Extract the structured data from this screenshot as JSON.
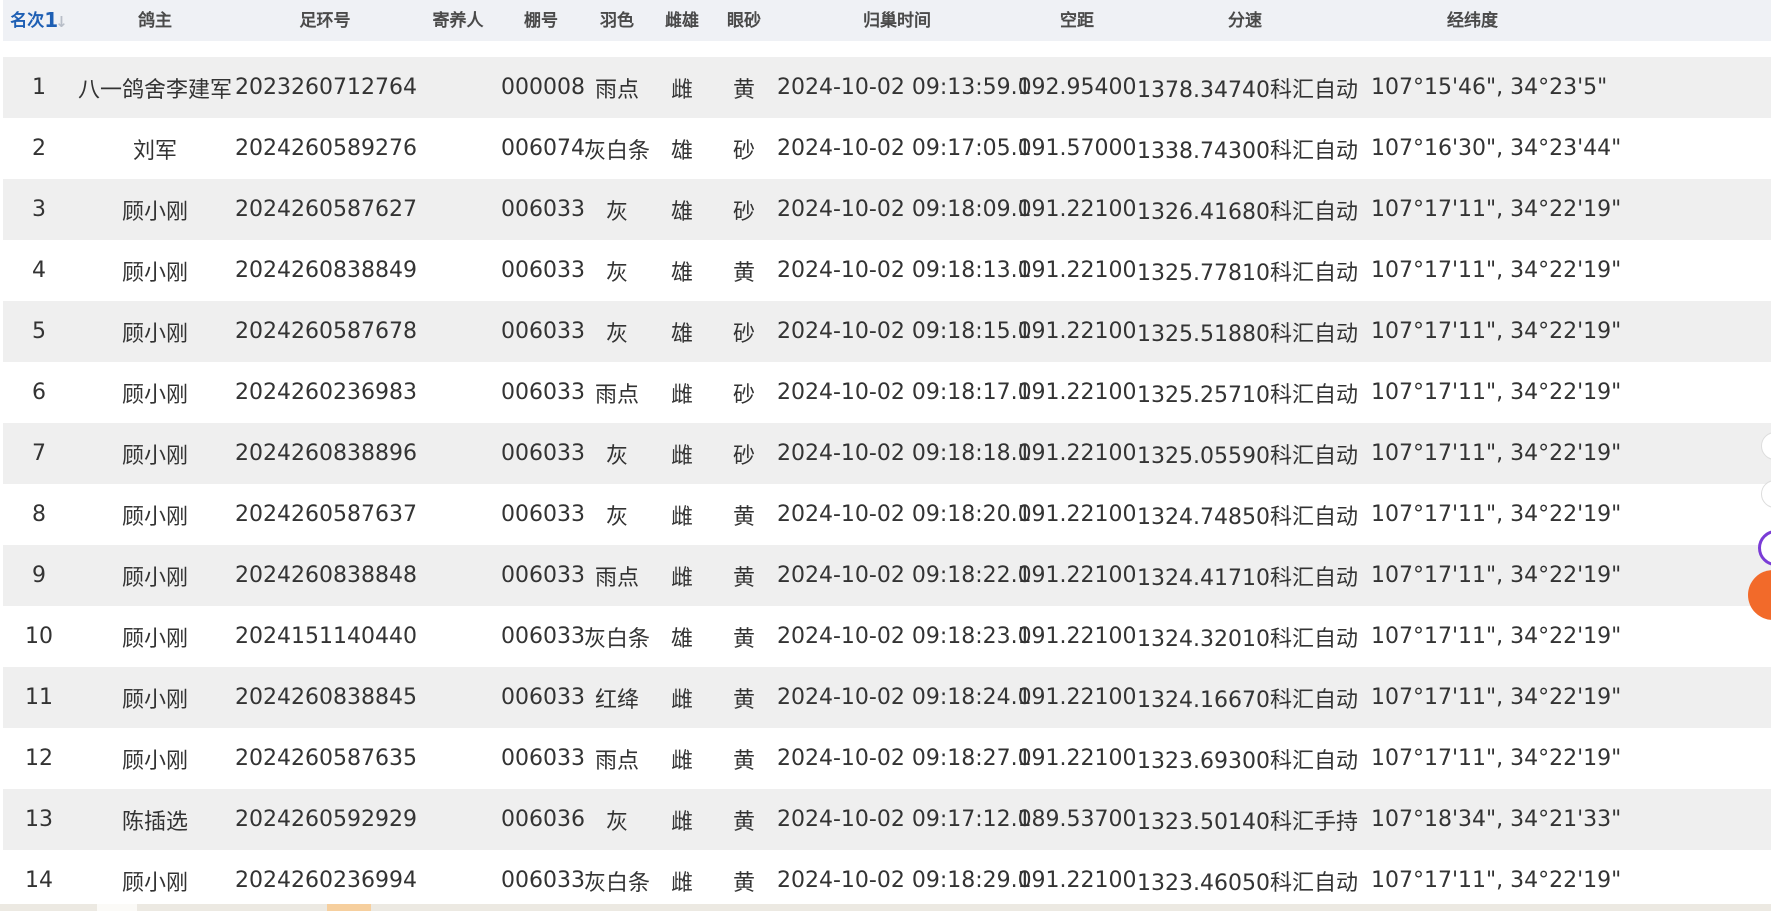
{
  "table": {
    "columns": [
      {
        "key": "rank",
        "label": "名次"
      },
      {
        "key": "owner",
        "label": "鸽主"
      },
      {
        "key": "ring",
        "label": "足环号"
      },
      {
        "key": "keeper",
        "label": "寄养人"
      },
      {
        "key": "shed",
        "label": "棚号"
      },
      {
        "key": "color",
        "label": "羽色"
      },
      {
        "key": "sex",
        "label": "雌雄"
      },
      {
        "key": "eye",
        "label": "眼砂"
      },
      {
        "key": "arrival",
        "label": "归巢时间"
      },
      {
        "key": "distance",
        "label": "空距"
      },
      {
        "key": "speed",
        "label": "分速"
      },
      {
        "key": "coords",
        "label": "经纬度"
      }
    ],
    "sort_indicator": "1",
    "rows": [
      {
        "rank": "1",
        "owner": "八一鸽舍李建军",
        "ring": "2023260712764",
        "keeper": "",
        "shed": "000008",
        "color": "雨点",
        "sex": "雌",
        "eye": "黄",
        "arrival": "2024-10-02 09:13:59.0",
        "distance": "192.95400",
        "speed": "1378.34740科汇自动",
        "coords": "107°15'46\", 34°23'5\""
      },
      {
        "rank": "2",
        "owner": "刘军",
        "ring": "2024260589276",
        "keeper": "",
        "shed": "006074",
        "color": "灰白条",
        "sex": "雄",
        "eye": "砂",
        "arrival": "2024-10-02 09:17:05.0",
        "distance": "191.57000",
        "speed": "1338.74300科汇自动",
        "coords": "107°16'30\", 34°23'44\""
      },
      {
        "rank": "3",
        "owner": "顾小刚",
        "ring": "2024260587627",
        "keeper": "",
        "shed": "006033",
        "color": "灰",
        "sex": "雄",
        "eye": "砂",
        "arrival": "2024-10-02 09:18:09.0",
        "distance": "191.22100",
        "speed": "1326.41680科汇自动",
        "coords": "107°17'11\", 34°22'19\""
      },
      {
        "rank": "4",
        "owner": "顾小刚",
        "ring": "2024260838849",
        "keeper": "",
        "shed": "006033",
        "color": "灰",
        "sex": "雄",
        "eye": "黄",
        "arrival": "2024-10-02 09:18:13.0",
        "distance": "191.22100",
        "speed": "1325.77810科汇自动",
        "coords": "107°17'11\", 34°22'19\""
      },
      {
        "rank": "5",
        "owner": "顾小刚",
        "ring": "2024260587678",
        "keeper": "",
        "shed": "006033",
        "color": "灰",
        "sex": "雄",
        "eye": "砂",
        "arrival": "2024-10-02 09:18:15.0",
        "distance": "191.22100",
        "speed": "1325.51880科汇自动",
        "coords": "107°17'11\", 34°22'19\""
      },
      {
        "rank": "6",
        "owner": "顾小刚",
        "ring": "2024260236983",
        "keeper": "",
        "shed": "006033",
        "color": "雨点",
        "sex": "雌",
        "eye": "砂",
        "arrival": "2024-10-02 09:18:17.0",
        "distance": "191.22100",
        "speed": "1325.25710科汇自动",
        "coords": "107°17'11\", 34°22'19\""
      },
      {
        "rank": "7",
        "owner": "顾小刚",
        "ring": "2024260838896",
        "keeper": "",
        "shed": "006033",
        "color": "灰",
        "sex": "雌",
        "eye": "砂",
        "arrival": "2024-10-02 09:18:18.0",
        "distance": "191.22100",
        "speed": "1325.05590科汇自动",
        "coords": "107°17'11\", 34°22'19\""
      },
      {
        "rank": "8",
        "owner": "顾小刚",
        "ring": "2024260587637",
        "keeper": "",
        "shed": "006033",
        "color": "灰",
        "sex": "雌",
        "eye": "黄",
        "arrival": "2024-10-02 09:18:20.0",
        "distance": "191.22100",
        "speed": "1324.74850科汇自动",
        "coords": "107°17'11\", 34°22'19\""
      },
      {
        "rank": "9",
        "owner": "顾小刚",
        "ring": "2024260838848",
        "keeper": "",
        "shed": "006033",
        "color": "雨点",
        "sex": "雌",
        "eye": "黄",
        "arrival": "2024-10-02 09:18:22.0",
        "distance": "191.22100",
        "speed": "1324.41710科汇自动",
        "coords": "107°17'11\", 34°22'19\""
      },
      {
        "rank": "10",
        "owner": "顾小刚",
        "ring": "2024151140440",
        "keeper": "",
        "shed": "006033",
        "color": "灰白条",
        "sex": "雄",
        "eye": "黄",
        "arrival": "2024-10-02 09:18:23.0",
        "distance": "191.22100",
        "speed": "1324.32010科汇自动",
        "coords": "107°17'11\", 34°22'19\""
      },
      {
        "rank": "11",
        "owner": "顾小刚",
        "ring": "2024260838845",
        "keeper": "",
        "shed": "006033",
        "color": "红绛",
        "sex": "雌",
        "eye": "黄",
        "arrival": "2024-10-02 09:18:24.0",
        "distance": "191.22100",
        "speed": "1324.16670科汇自动",
        "coords": "107°17'11\", 34°22'19\""
      },
      {
        "rank": "12",
        "owner": "顾小刚",
        "ring": "2024260587635",
        "keeper": "",
        "shed": "006033",
        "color": "雨点",
        "sex": "雌",
        "eye": "黄",
        "arrival": "2024-10-02 09:18:27.0",
        "distance": "191.22100",
        "speed": "1323.69300科汇自动",
        "coords": "107°17'11\", 34°22'19\""
      },
      {
        "rank": "13",
        "owner": "陈插选",
        "ring": "2024260592929",
        "keeper": "",
        "shed": "006036",
        "color": "灰",
        "sex": "雌",
        "eye": "黄",
        "arrival": "2024-10-02 09:17:12.0",
        "distance": "189.53700",
        "speed": "1323.50140科汇手持",
        "coords": "107°18'34\", 34°21'33\""
      },
      {
        "rank": "14",
        "owner": "顾小刚",
        "ring": "2024260236994",
        "keeper": "",
        "shed": "006033",
        "color": "灰白条",
        "sex": "雌",
        "eye": "黄",
        "arrival": "2024-10-02 09:18:29.0",
        "distance": "191.22100",
        "speed": "1323.46050科汇自动",
        "coords": "107°17'11\", 34°22'19\""
      }
    ]
  },
  "colors": {
    "header_bg": "#eff1f5",
    "sorted_header": "#1e5fb4",
    "row_alt": "#efefef",
    "text": "#333333"
  }
}
